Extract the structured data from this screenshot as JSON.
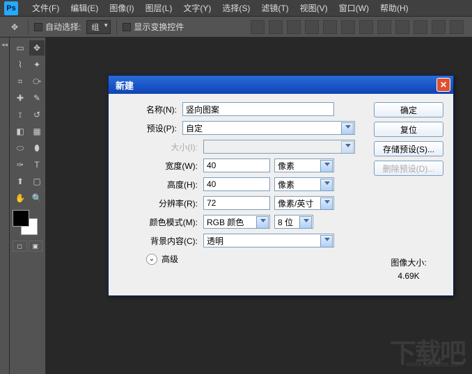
{
  "menubar": {
    "items": [
      "文件(F)",
      "编辑(E)",
      "图像(I)",
      "图层(L)",
      "文字(Y)",
      "选择(S)",
      "滤镜(T)",
      "视图(V)",
      "窗口(W)",
      "帮助(H)"
    ]
  },
  "optbar": {
    "auto_select": "自动选择:",
    "group": "组",
    "show_transform": "显示变换控件"
  },
  "dialog": {
    "title": "新建",
    "labels": {
      "name": "名称(N):",
      "preset": "预设(P):",
      "size": "大小(I):",
      "width": "宽度(W):",
      "height": "高度(H):",
      "resolution": "分辨率(R):",
      "color_mode": "颜色模式(M):",
      "bg": "背景内容(C):",
      "advanced": "高级"
    },
    "values": {
      "name": "竖向图案",
      "preset": "自定",
      "width": "40",
      "height": "40",
      "resolution": "72",
      "color_mode": "RGB 颜色",
      "bits": "8 位",
      "bg": "透明",
      "unit_px": "像素",
      "unit_ppi": "像素/英寸"
    },
    "buttons": {
      "ok": "确定",
      "reset": "复位",
      "save_preset": "存储预设(S)...",
      "delete_preset": "删除预设(D)..."
    },
    "image_size_label": "图像大小:",
    "image_size_value": "4.69K"
  },
  "watermark": {
    "big": "下载吧",
    "small": "www.xiazaiba.com"
  }
}
